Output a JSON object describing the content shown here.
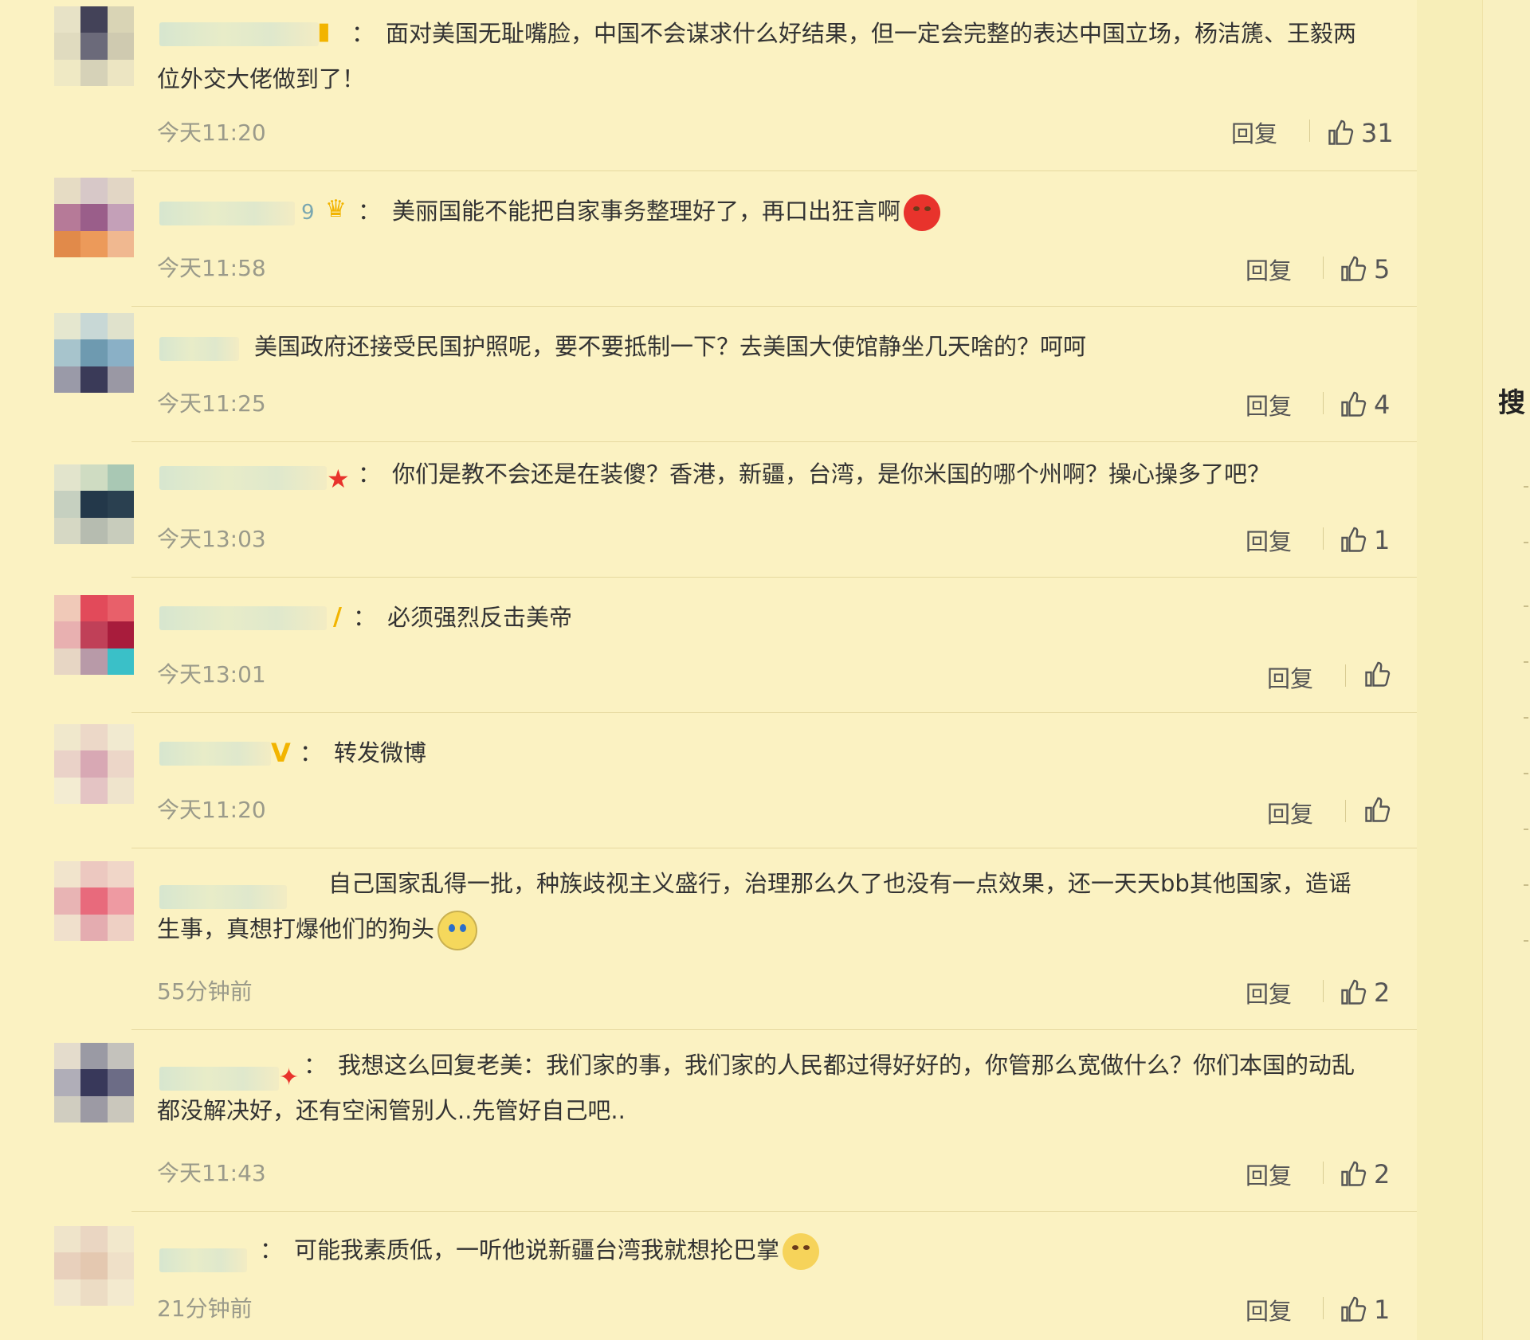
{
  "reply_label": "回复",
  "side_label": "搜",
  "comments": [
    {
      "text": "面对美国无耻嘴脸，中国不会谋求什么好结果，但一定会完整的表达中国立场，杨洁篪、王毅两位外交大佬做到了！",
      "time": "今天11:20",
      "likes": "31",
      "badge": "",
      "name_suffix": ""
    },
    {
      "text": "美丽国能不能把自家事务整理好了，再口出狂言啊",
      "time": "今天11:58",
      "likes": "5",
      "badge": "crown",
      "name_suffix": "9"
    },
    {
      "text": "美国政府还接受民国护照呢，要不要抵制一下？去美国大使馆静坐几天啥的？呵呵",
      "time": "今天11:25",
      "likes": "4",
      "badge": "",
      "name_suffix": ""
    },
    {
      "text": "你们是教不会还是在装傻？香港，新疆，台湾，是你米国的哪个州啊？操心操多了吧？",
      "time": "今天13:03",
      "likes": "1",
      "badge": "star",
      "name_suffix": ""
    },
    {
      "text": "必须强烈反击美帝",
      "time": "今天13:01",
      "likes": "",
      "badge": "v-partial",
      "name_suffix": ""
    },
    {
      "text": "转发微博",
      "time": "今天11:20",
      "likes": "",
      "badge": "v",
      "name_suffix": ""
    },
    {
      "text": "自己国家乱得一批，种族歧视主义盛行，治理那么久了也没有一点效果，还一天天bb其他国家，造谣生事，真想打爆他们的狗头",
      "time": "55分钟前",
      "likes": "2",
      "badge": "",
      "name_suffix": ""
    },
    {
      "text": "我想这么回复老美：我们家的事，我们家的人民都过得好好的，你管那么宽做什么？你们本国的动乱都没解决好，还有空闲管别人..先管好自己吧..",
      "time": "今天11:43",
      "likes": "2",
      "badge": "partial",
      "name_suffix": ""
    },
    {
      "text": "可能我素质低，一听他说新疆台湾我就想抡巴掌",
      "time": "21分钟前",
      "likes": "1",
      "badge": "",
      "name_suffix": ""
    }
  ],
  "colors": {
    "background": "#fbf2c2",
    "star": "#e8332c",
    "vip": "#f2b400"
  }
}
